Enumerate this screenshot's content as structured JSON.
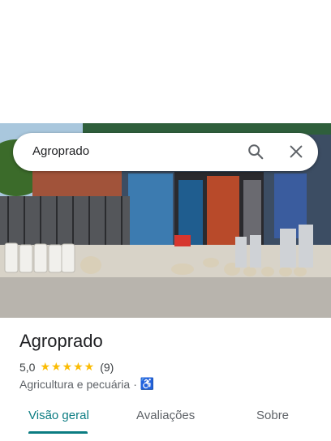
{
  "search": {
    "query": "Agroprado"
  },
  "place": {
    "name": "Agroprado",
    "rating": "5,0",
    "stars": "★★★★★",
    "review_count": "(9)",
    "category": "Agricultura e pecuária",
    "separator": "·"
  },
  "tabs": [
    {
      "label": "Visão geral",
      "active": true
    },
    {
      "label": "Avaliações",
      "active": false
    },
    {
      "label": "Sobre",
      "active": false
    }
  ],
  "colors": {
    "accent": "#0b7c82",
    "star": "#fbbc04",
    "a11y": "#1a73e8"
  },
  "icons": [
    "search-icon",
    "close-icon",
    "wheelchair-icon"
  ]
}
